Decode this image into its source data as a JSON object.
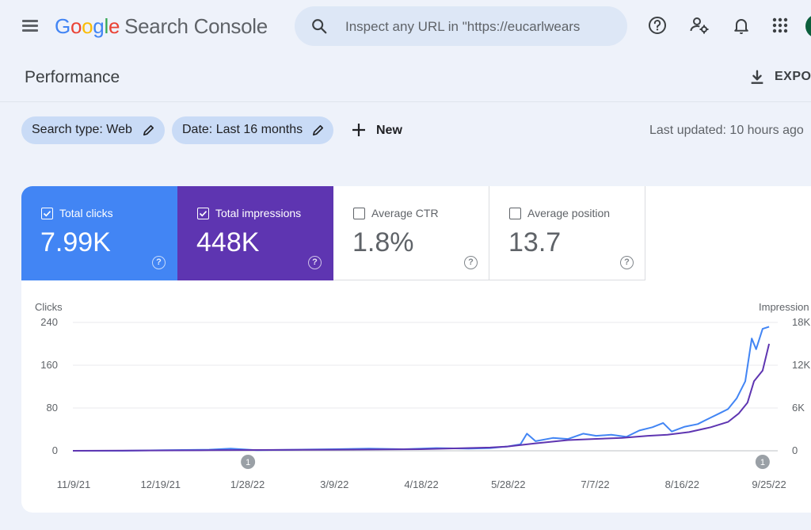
{
  "app": {
    "brand_letters": [
      "G",
      "o",
      "o",
      "g",
      "l",
      "e"
    ],
    "product": "Search Console",
    "search_placeholder": "Inspect any URL in \"https://eucarlwears",
    "icons": [
      "menu-icon",
      "search-icon",
      "help-icon",
      "manage-users-icon",
      "bell-icon",
      "apps-grid-icon"
    ],
    "colors": {
      "clicks": "#4285f4",
      "impressions": "#5e35b1",
      "background": "#eef2fa",
      "chip": "#c9dbf6"
    }
  },
  "header": {
    "title": "Performance",
    "export_label": "EXPOR"
  },
  "filters": {
    "chips": [
      {
        "label": "Search type: Web"
      },
      {
        "label": "Date: Last 16 months"
      }
    ],
    "new_label": "New",
    "last_updated": "Last updated: 10 hours ago"
  },
  "metrics": [
    {
      "label": "Total clicks",
      "value": "7.99K",
      "selected": true
    },
    {
      "label": "Total impressions",
      "value": "448K",
      "selected": true
    },
    {
      "label": "Average CTR",
      "value": "1.8%",
      "selected": false
    },
    {
      "label": "Average position",
      "value": "13.7",
      "selected": false
    }
  ],
  "chart_data": {
    "type": "line",
    "title": "",
    "ylabel": "Clicks",
    "y2label": "Impression",
    "ylim": [
      0,
      240
    ],
    "y2lim": [
      0,
      18000
    ],
    "yticks": [
      "240",
      "160",
      "80",
      "0"
    ],
    "y2ticks": [
      "18K",
      "12K",
      "6K",
      "0"
    ],
    "xticks": [
      "11/9/21",
      "12/19/21",
      "1/28/22",
      "3/9/22",
      "4/18/22",
      "5/28/22",
      "7/7/22",
      "8/16/22",
      "9/25/22"
    ],
    "x_range": [
      "2021-11-08",
      "2022-09-30"
    ],
    "annotations": [
      {
        "date": "2022-01-28",
        "label": "1"
      },
      {
        "date": "2022-09-23",
        "label": "1"
      }
    ],
    "grid": true,
    "series": [
      {
        "name": "Clicks",
        "axis": "left",
        "color": "#4285f4",
        "points": [
          [
            "2021-11-08",
            0
          ],
          [
            "2021-12-01",
            0
          ],
          [
            "2021-12-20",
            1
          ],
          [
            "2022-01-10",
            2
          ],
          [
            "2022-01-20",
            4
          ],
          [
            "2022-02-01",
            1
          ],
          [
            "2022-02-20",
            2
          ],
          [
            "2022-03-09",
            3
          ],
          [
            "2022-03-25",
            4
          ],
          [
            "2022-04-10",
            3
          ],
          [
            "2022-04-25",
            5
          ],
          [
            "2022-05-10",
            4
          ],
          [
            "2022-05-20",
            5
          ],
          [
            "2022-05-28",
            8
          ],
          [
            "2022-06-03",
            12
          ],
          [
            "2022-06-06",
            32
          ],
          [
            "2022-06-10",
            18
          ],
          [
            "2022-06-18",
            24
          ],
          [
            "2022-06-25",
            22
          ],
          [
            "2022-07-02",
            32
          ],
          [
            "2022-07-08",
            28
          ],
          [
            "2022-07-15",
            30
          ],
          [
            "2022-07-22",
            26
          ],
          [
            "2022-07-28",
            38
          ],
          [
            "2022-08-03",
            44
          ],
          [
            "2022-08-08",
            52
          ],
          [
            "2022-08-12",
            36
          ],
          [
            "2022-08-18",
            45
          ],
          [
            "2022-08-24",
            50
          ],
          [
            "2022-08-30",
            62
          ],
          [
            "2022-09-03",
            70
          ],
          [
            "2022-09-07",
            78
          ],
          [
            "2022-09-11",
            98
          ],
          [
            "2022-09-15",
            130
          ],
          [
            "2022-09-18",
            210
          ],
          [
            "2022-09-20",
            190
          ],
          [
            "2022-09-23",
            228
          ],
          [
            "2022-09-26",
            232
          ]
        ]
      },
      {
        "name": "Impressions",
        "axis": "right",
        "color": "#5e35b1",
        "points": [
          [
            "2021-11-08",
            0
          ],
          [
            "2022-01-10",
            75
          ],
          [
            "2022-03-09",
            150
          ],
          [
            "2022-04-18",
            225
          ],
          [
            "2022-05-20",
            450
          ],
          [
            "2022-05-28",
            600
          ],
          [
            "2022-06-10",
            1050
          ],
          [
            "2022-06-25",
            1500
          ],
          [
            "2022-07-07",
            1650
          ],
          [
            "2022-07-20",
            1800
          ],
          [
            "2022-08-01",
            2100
          ],
          [
            "2022-08-10",
            2250
          ],
          [
            "2022-08-20",
            2625
          ],
          [
            "2022-08-30",
            3300
          ],
          [
            "2022-09-07",
            4050
          ],
          [
            "2022-09-12",
            5250
          ],
          [
            "2022-09-16",
            6750
          ],
          [
            "2022-09-19",
            9750
          ],
          [
            "2022-09-23",
            11250
          ],
          [
            "2022-09-26",
            15000
          ]
        ]
      }
    ]
  }
}
